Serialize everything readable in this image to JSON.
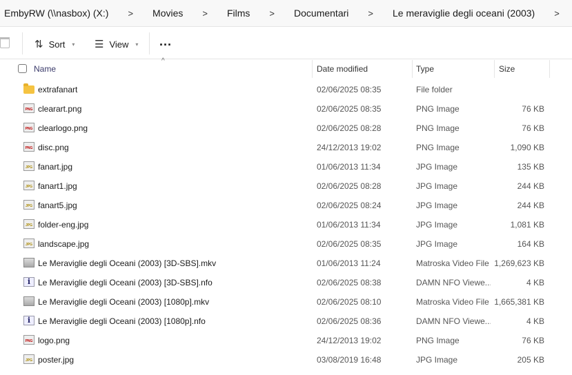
{
  "breadcrumb": [
    "EmbyRW (\\\\nasbox) (X:)",
    "Movies",
    "Films",
    "Documentari",
    "Le meraviglie degli oceani (2003)"
  ],
  "toolbar": {
    "sort": "Sort",
    "view": "View",
    "more": "..."
  },
  "columns": {
    "name": "Name",
    "date": "Date modified",
    "type": "Type",
    "size": "Size"
  },
  "files": [
    {
      "icon": "folder",
      "name": "extrafanart",
      "date": "02/06/2025 08:35",
      "type": "File folder",
      "size": ""
    },
    {
      "icon": "png",
      "name": "clearart.png",
      "date": "02/06/2025 08:35",
      "type": "PNG Image",
      "size": "76 KB"
    },
    {
      "icon": "png",
      "name": "clearlogo.png",
      "date": "02/06/2025 08:28",
      "type": "PNG Image",
      "size": "76 KB"
    },
    {
      "icon": "png",
      "name": "disc.png",
      "date": "24/12/2013 19:02",
      "type": "PNG Image",
      "size": "1,090 KB"
    },
    {
      "icon": "jpg",
      "name": "fanart.jpg",
      "date": "01/06/2013 11:34",
      "type": "JPG Image",
      "size": "135 KB"
    },
    {
      "icon": "jpg",
      "name": "fanart1.jpg",
      "date": "02/06/2025 08:28",
      "type": "JPG Image",
      "size": "244 KB"
    },
    {
      "icon": "jpg",
      "name": "fanart5.jpg",
      "date": "02/06/2025 08:24",
      "type": "JPG Image",
      "size": "244 KB"
    },
    {
      "icon": "jpg",
      "name": "folder-eng.jpg",
      "date": "01/06/2013 11:34",
      "type": "JPG Image",
      "size": "1,081 KB"
    },
    {
      "icon": "jpg",
      "name": "landscape.jpg",
      "date": "02/06/2025 08:35",
      "type": "JPG Image",
      "size": "164 KB"
    },
    {
      "icon": "video",
      "name": "Le Meraviglie degli Oceani (2003) [3D-SBS].mkv",
      "date": "01/06/2013 11:24",
      "type": "Matroska Video File",
      "size": "1,269,623 KB"
    },
    {
      "icon": "nfo",
      "name": "Le Meraviglie degli Oceani (2003) [3D-SBS].nfo",
      "date": "02/06/2025 08:38",
      "type": "DAMN NFO Viewe...",
      "size": "4 KB"
    },
    {
      "icon": "video",
      "name": "Le Meraviglie degli Oceani (2003) [1080p].mkv",
      "date": "02/06/2025 08:10",
      "type": "Matroska Video File",
      "size": "1,665,381 KB"
    },
    {
      "icon": "nfo",
      "name": "Le Meraviglie degli Oceani (2003) [1080p].nfo",
      "date": "02/06/2025 08:36",
      "type": "DAMN NFO Viewe...",
      "size": "4 KB"
    },
    {
      "icon": "png",
      "name": "logo.png",
      "date": "24/12/2013 19:02",
      "type": "PNG Image",
      "size": "76 KB"
    },
    {
      "icon": "jpg",
      "name": "poster.jpg",
      "date": "03/08/2019 16:48",
      "type": "JPG Image",
      "size": "205 KB"
    }
  ]
}
